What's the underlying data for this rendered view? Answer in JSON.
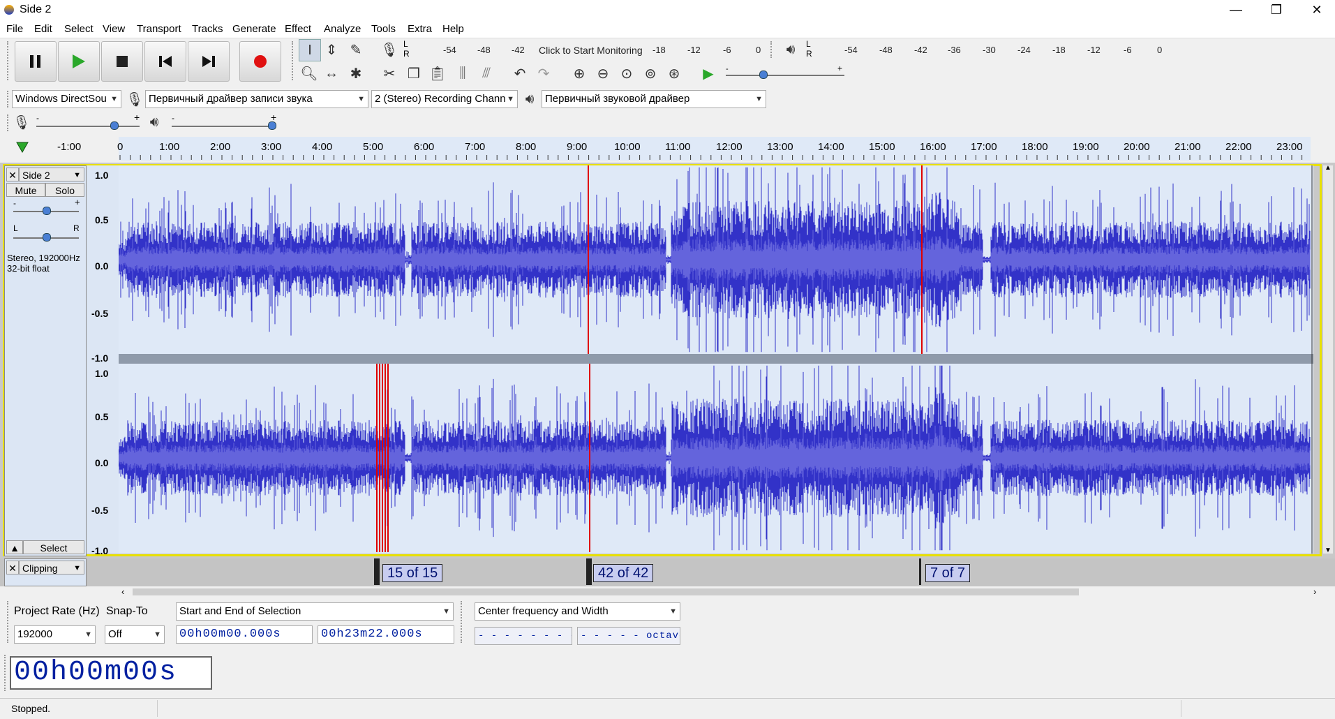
{
  "window": {
    "title": "Side 2",
    "minimize": "—",
    "maximize": "❐",
    "close": "✕"
  },
  "menu": [
    "File",
    "Edit",
    "Select",
    "View",
    "Transport",
    "Tracks",
    "Generate",
    "Effect",
    "Analyze",
    "Tools",
    "Extra",
    "Help"
  ],
  "meter_record": {
    "lr_top": "L",
    "lr_bottom": "R",
    "click_text": "Click to Start Monitoring",
    "ticks": [
      "-54",
      "-48",
      "-42",
      "-18",
      "-12",
      "-6",
      "0"
    ]
  },
  "meter_play": {
    "lr_top": "L",
    "lr_bottom": "R",
    "ticks": [
      "-54",
      "-48",
      "-42",
      "-36",
      "-30",
      "-24",
      "-18",
      "-12",
      "-6",
      "0"
    ]
  },
  "devices": {
    "host": "Windows DirectSou",
    "record_device": "Первичный драйвер записи звука",
    "channels": "2 (Stereo) Recording Chann",
    "playback_device": "Первичный звуковой драйвер"
  },
  "mixer": {
    "minus": "-",
    "plus": "+"
  },
  "ruler": {
    "ticks": [
      "-1:00",
      "0",
      "1:00",
      "2:00",
      "3:00",
      "4:00",
      "5:00",
      "6:00",
      "7:00",
      "8:00",
      "9:00",
      "10:00",
      "11:00",
      "12:00",
      "13:00",
      "14:00",
      "15:00",
      "16:00",
      "17:00",
      "18:00",
      "19:00",
      "20:00",
      "21:00",
      "22:00",
      "23:00"
    ]
  },
  "track": {
    "name": "Side 2",
    "close": "✕",
    "mute": "Mute",
    "solo": "Solo",
    "gain_minus": "-",
    "gain_plus": "+",
    "pan_left": "L",
    "pan_right": "R",
    "info": "Stereo, 192000Hz\n32-bit float",
    "select": "Select",
    "collapse": "▲",
    "scale": [
      "1.0",
      "0.5",
      "0.0",
      "-0.5",
      "-1.0"
    ]
  },
  "label_track": {
    "name": "Clipping",
    "close": "✕",
    "labels": [
      "15 of 15",
      "42 of 42",
      "7 of 7"
    ]
  },
  "colors": {
    "wave_outer": "#3232c8",
    "wave_inner": "#6464dc",
    "wave_bg": "#dfe9f7",
    "clip": "#e00000",
    "label_bg": "#c8cdf0"
  },
  "selection": {
    "project_rate_label": "Project Rate (Hz)",
    "snap_label": "Snap-To",
    "project_rate": "192000",
    "snap": "Off",
    "sel_mode": "Start and End of Selection",
    "start": "00h00m00.000s",
    "end": "00h23m22.000s",
    "spectral_mode": "Center frequency and Width",
    "freq": "- - - - - - - -Hz",
    "octaves": "- - - - - octaves"
  },
  "time": "00h00m00s",
  "status": "Stopped."
}
